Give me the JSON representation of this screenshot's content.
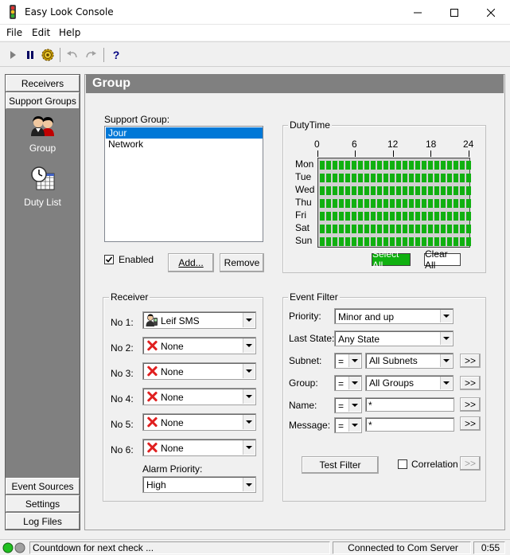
{
  "window": {
    "title": "Easy Look Console"
  },
  "menu": [
    "File",
    "Edit",
    "Help"
  ],
  "toolbar": {
    "icons": [
      "play-icon",
      "pause-icon",
      "gear-icon",
      "undo-icon",
      "redo-icon",
      "help-icon"
    ],
    "help_glyph": "?"
  },
  "nav": {
    "tabs_top": [
      "Receivers",
      "Support Groups"
    ],
    "items": [
      {
        "label": "Group",
        "icon": "people-icon"
      },
      {
        "label": "Duty List",
        "icon": "clock-calendar-icon"
      }
    ],
    "tabs_bottom": [
      "Event Sources",
      "Settings",
      "Log Files"
    ]
  },
  "header": {
    "title": "Group"
  },
  "support_group": {
    "label": "Support Group:",
    "items": [
      "Jour",
      "Network"
    ],
    "selected_index": 0,
    "enabled_label": "Enabled",
    "enabled_checked": true,
    "add_label": "Add...",
    "remove_label": "Remove"
  },
  "duty_time": {
    "label": "DutyTime",
    "hours": [
      "0",
      "6",
      "12",
      "18",
      "24"
    ],
    "days": [
      "Mon",
      "Tue",
      "Wed",
      "Thu",
      "Fri",
      "Sat",
      "Sun"
    ],
    "all_selected": true,
    "select_all_label": "Select All",
    "clear_all_label": "Clear All",
    "active_color": "#10b010"
  },
  "receiver": {
    "label": "Receiver",
    "rows": [
      {
        "label": "No 1:",
        "value": "Leif SMS",
        "icon": "person-phone-icon"
      },
      {
        "label": "No 2:",
        "value": "None",
        "icon": "red-x-icon"
      },
      {
        "label": "No 3:",
        "value": "None",
        "icon": "red-x-icon"
      },
      {
        "label": "No 4:",
        "value": "None",
        "icon": "red-x-icon"
      },
      {
        "label": "No 5:",
        "value": "None",
        "icon": "red-x-icon"
      },
      {
        "label": "No 6:",
        "value": "None",
        "icon": "red-x-icon"
      }
    ],
    "alarm_priority_label": "Alarm Priority:",
    "alarm_priority_value": "High"
  },
  "event_filter": {
    "label": "Event Filter",
    "priority_label": "Priority:",
    "priority_value": "Minor and up",
    "last_state_label": "Last State:",
    "last_state_value": "Any State",
    "subnet_label": "Subnet:",
    "subnet_op": "=",
    "subnet_value": "All Subnets",
    "group_label": "Group:",
    "group_op": "=",
    "group_value": "All Groups",
    "name_label": "Name:",
    "name_op": "=",
    "name_value": "*",
    "message_label": "Message:",
    "message_op": "=",
    "message_value": "*",
    "more_label": ">>",
    "test_filter_label": "Test Filter",
    "correlation_label": "Correlation",
    "correlation_checked": false
  },
  "status": {
    "message": "Countdown for next check ...",
    "connection": "Connected to Com Server",
    "time": "0:55"
  }
}
